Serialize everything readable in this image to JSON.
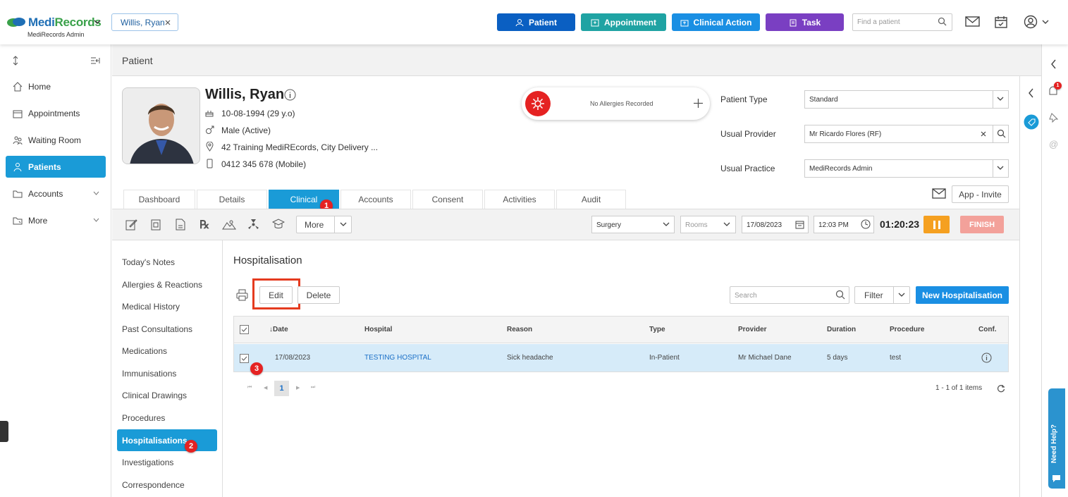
{
  "app": {
    "name_a": "Medi",
    "name_b": "Records",
    "subtitle": "MediRecords Admin"
  },
  "patient_tab": {
    "label": "Willis, Ryan"
  },
  "header_buttons": [
    {
      "label": "Patient",
      "color": "#0a5fc2"
    },
    {
      "label": "Appointment",
      "color": "#1fa3a3"
    },
    {
      "label": "Clinical Action",
      "color": "#1a8fe3"
    },
    {
      "label": "Task",
      "color": "#7a3fc2"
    }
  ],
  "find_patient": {
    "placeholder": "Find a patient"
  },
  "sidebar": {
    "items": [
      {
        "label": "Home",
        "icon": "home-icon"
      },
      {
        "label": "Appointments",
        "icon": "calendar-icon"
      },
      {
        "label": "Waiting Room",
        "icon": "waiting-room-icon"
      },
      {
        "label": "Patients",
        "icon": "patients-icon",
        "active": true
      },
      {
        "label": "Accounts",
        "icon": "folder-icon"
      },
      {
        "label": "More",
        "icon": "more-icon"
      }
    ]
  },
  "page": {
    "title": "Patient"
  },
  "patient": {
    "name": "Willis, Ryan",
    "dob": "10-08-1994 (29 y.o)",
    "gender": "Male (Active)",
    "address": "42 Training MediREcords, City Delivery ...",
    "phone": "0412 345 678 (Mobile)"
  },
  "allergies": {
    "text": "No Allergies Recorded"
  },
  "patient_fields": {
    "type_label": "Patient Type",
    "type_value": "Standard",
    "provider_label": "Usual Provider",
    "provider_value": "Mr Ricardo Flores (RF)",
    "practice_label": "Usual Practice",
    "practice_value": "MediRecords Admin"
  },
  "app_invite": "App - Invite",
  "tabs": [
    "Dashboard",
    "Details",
    "Clinical",
    "Accounts",
    "Consent",
    "Activities",
    "Audit"
  ],
  "toolbar": {
    "more": "More",
    "surgery": "Surgery",
    "rooms": "Rooms",
    "date": "17/08/2023",
    "time": "12:03 PM",
    "timer": "01:20:23",
    "finish": "FINISH"
  },
  "subnav": [
    "Today's Notes",
    "Allergies & Reactions",
    "Medical History",
    "Past Consultations",
    "Medications",
    "Immunisations",
    "Clinical Drawings",
    "Procedures",
    "Hospitalisations",
    "Investigations",
    "Correspondence"
  ],
  "section": {
    "title": "Hospitalisation",
    "edit": "Edit",
    "delete": "Delete",
    "search_placeholder": "Search",
    "filter": "Filter",
    "new": "New Hospitalisation"
  },
  "table": {
    "headers": [
      "↓Date",
      "Hospital",
      "Reason",
      "Type",
      "Provider",
      "Duration",
      "Procedure",
      "Conf."
    ],
    "row": {
      "date": "17/08/2023",
      "hospital": "TESTING HOSPITAL",
      "reason": "Sick headache",
      "type": "In-Patient",
      "provider": "Mr Michael Dane",
      "duration": "5 days",
      "procedure": "test"
    }
  },
  "pager": {
    "page": "1",
    "summary": "1 - 1 of 1 items"
  },
  "steps": [
    "1",
    "2",
    "3"
  ],
  "notif_count": "1",
  "help": "Need Help?"
}
